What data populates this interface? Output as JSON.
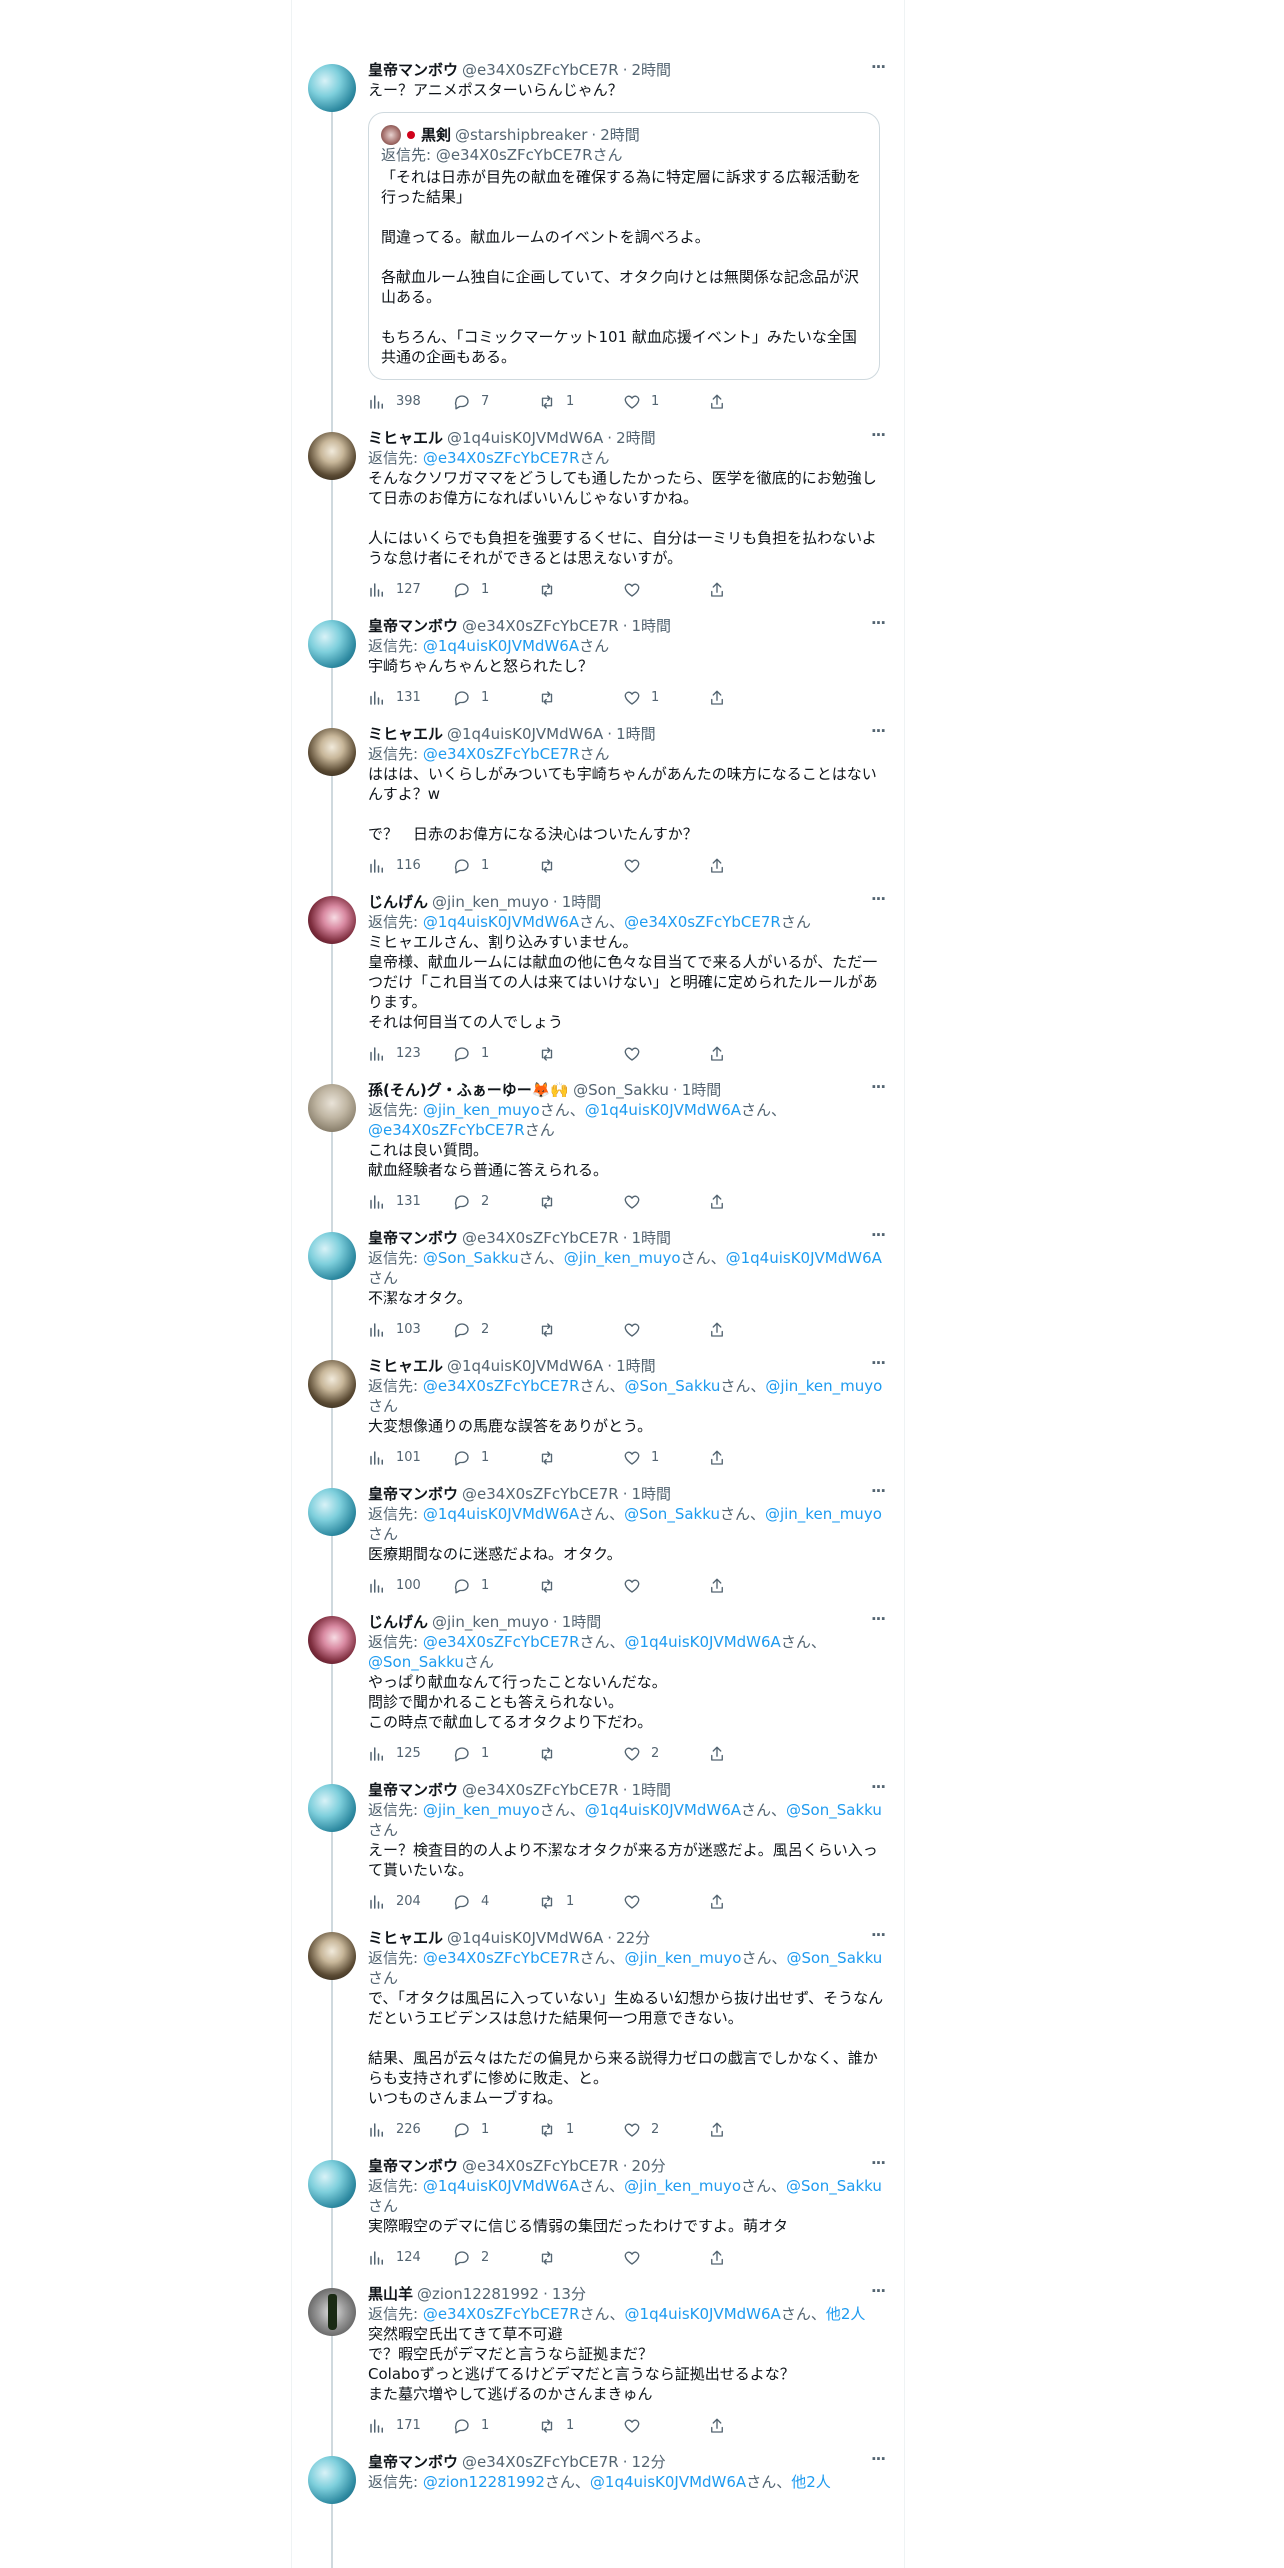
{
  "tweets": [
    {
      "avatar": "blue-whale-avatar",
      "name": "皇帝マンボウ",
      "handle": "@e34X0sZFcYbCE7R",
      "time": "2時間",
      "reply_prefix": "",
      "reply_to": [],
      "reply_suffix": "",
      "text": "えー？アニメポスターいらんじゃん？",
      "quote": {
        "name": "黒剣",
        "handle": "@starshipbreaker",
        "time": "2時間",
        "reply_label": "返信先: @e34X0sZFcYbCE7Rさん",
        "text": "「それは日赤が目先の献血を確保する為に特定層に訴求する広報活動を行った結果」\n\n間違ってる。献血ルームのイベントを調べろよ。\n\n各献血ルーム独自に企画していて、オタク向けとは無関係な記念品が沢山ある。\n\nもちろん、「コミックマーケット101 献血応援イベント」みたいな全国共通の企画もある。"
      },
      "views": "398",
      "replies": "7",
      "retweets": "1",
      "likes": "1"
    },
    {
      "avatar": "old-man-avatar",
      "name": "ミヒャエル",
      "handle": "@1q4uisK0JVMdW6A",
      "time": "2時間",
      "reply_prefix": "返信先: ",
      "reply_to": [
        "@e34X0sZFcYbCE7R"
      ],
      "reply_suffix": "さん",
      "text": "そんなクソワガママをどうしても通したかったら、医学を徹底的にお勉強して日赤のお偉方になればいいんじゃないすかね。\n\n人にはいくらでも負担を強要するくせに、自分は一ミリも負担を払わないような怠け者にそれができるとは思えないすが。",
      "views": "127",
      "replies": "1",
      "retweets": "",
      "likes": ""
    },
    {
      "avatar": "blue-whale-avatar",
      "name": "皇帝マンボウ",
      "handle": "@e34X0sZFcYbCE7R",
      "time": "1時間",
      "reply_prefix": "返信先: ",
      "reply_to": [
        "@1q4uisK0JVMdW6A"
      ],
      "reply_suffix": "さん",
      "text": "宇崎ちゃんちゃんと怒られたし？",
      "views": "131",
      "replies": "1",
      "retweets": "",
      "likes": "1"
    },
    {
      "avatar": "old-man-avatar",
      "name": "ミヒャエル",
      "handle": "@1q4uisK0JVMdW6A",
      "time": "1時間",
      "reply_prefix": "返信先: ",
      "reply_to": [
        "@e34X0sZFcYbCE7R"
      ],
      "reply_suffix": "さん",
      "text": "ははは、いくらしがみついても宇崎ちゃんがあんたの味方になることはないんすよ？w\n\nで？　日赤のお偉方になる決心はついたんすか？",
      "views": "116",
      "replies": "1",
      "retweets": "",
      "likes": ""
    },
    {
      "avatar": "anime-avatar",
      "name": "じんげん",
      "handle": "@jin_ken_muyo",
      "time": "1時間",
      "reply_prefix": "返信先: ",
      "reply_to": [
        "@1q4uisK0JVMdW6A",
        "@e34X0sZFcYbCE7R"
      ],
      "reply_suffix": "さん",
      "text": "ミヒャエルさん、割り込みすいません。\n皇帝様、献血ルームには献血の他に色々な目当てで来る人がいるが、ただ一つだけ「これ目当ての人は来てはいけない」と明確に定められたルールがあります。\nそれは何目当ての人でしょう",
      "views": "123",
      "replies": "1",
      "retweets": "",
      "likes": ""
    },
    {
      "avatar": "girl-avatar",
      "name": "孫(そん)グ・ふぁーゆー🦊🙌",
      "handle": "@Son_Sakku",
      "time": "1時間",
      "reply_prefix": "返信先: ",
      "reply_to": [
        "@jin_ken_muyo",
        "@1q4uisK0JVMdW6A",
        "@e34X0sZFcYbCE7R"
      ],
      "reply_suffix": "さん",
      "text": "これは良い質問。\n献血経験者なら普通に答えられる。",
      "views": "131",
      "replies": "2",
      "retweets": "",
      "likes": ""
    },
    {
      "avatar": "blue-whale-avatar",
      "name": "皇帝マンボウ",
      "handle": "@e34X0sZFcYbCE7R",
      "time": "1時間",
      "reply_prefix": "返信先: ",
      "reply_to": [
        "@Son_Sakku",
        "@jin_ken_muyo",
        "@1q4uisK0JVMdW6A"
      ],
      "reply_suffix": "さん",
      "text": "不潔なオタク。",
      "views": "103",
      "replies": "2",
      "retweets": "",
      "likes": ""
    },
    {
      "avatar": "old-man-avatar",
      "name": "ミヒャエル",
      "handle": "@1q4uisK0JVMdW6A",
      "time": "1時間",
      "reply_prefix": "返信先: ",
      "reply_to": [
        "@e34X0sZFcYbCE7R",
        "@Son_Sakku",
        "@jin_ken_muyo"
      ],
      "reply_suffix": "さん",
      "text": "大変想像通りの馬鹿な誤答をありがとう。",
      "views": "101",
      "replies": "1",
      "retweets": "",
      "likes": "1"
    },
    {
      "avatar": "blue-whale-avatar",
      "name": "皇帝マンボウ",
      "handle": "@e34X0sZFcYbCE7R",
      "time": "1時間",
      "reply_prefix": "返信先: ",
      "reply_to": [
        "@1q4uisK0JVMdW6A",
        "@Son_Sakku",
        "@jin_ken_muyo"
      ],
      "reply_suffix": "さん",
      "text": "医療期間なのに迷惑だよね。オタク。",
      "views": "100",
      "replies": "1",
      "retweets": "",
      "likes": ""
    },
    {
      "avatar": "anime-avatar",
      "name": "じんげん",
      "handle": "@jin_ken_muyo",
      "time": "1時間",
      "reply_prefix": "返信先: ",
      "reply_to": [
        "@e34X0sZFcYbCE7R",
        "@1q4uisK0JVMdW6A",
        "@Son_Sakku"
      ],
      "reply_suffix": "さん",
      "text": "やっぱり献血なんて行ったことないんだな。\n問診で聞かれることも答えられない。\nこの時点で献血してるオタクより下だわ。",
      "views": "125",
      "replies": "1",
      "retweets": "",
      "likes": "2"
    },
    {
      "avatar": "blue-whale-avatar",
      "name": "皇帝マンボウ",
      "handle": "@e34X0sZFcYbCE7R",
      "time": "1時間",
      "reply_prefix": "返信先: ",
      "reply_to": [
        "@jin_ken_muyo",
        "@1q4uisK0JVMdW6A",
        "@Son_Sakku"
      ],
      "reply_suffix": "さん",
      "text": "えー？検査目的の人より不潔なオタクが来る方が迷惑だよ。風呂くらい入って貰いたいな。",
      "views": "204",
      "replies": "4",
      "retweets": "1",
      "likes": ""
    },
    {
      "avatar": "old-man-avatar",
      "name": "ミヒャエル",
      "handle": "@1q4uisK0JVMdW6A",
      "time": "22分",
      "reply_prefix": "返信先: ",
      "reply_to": [
        "@e34X0sZFcYbCE7R",
        "@jin_ken_muyo",
        "@Son_Sakku"
      ],
      "reply_suffix": "さん",
      "text": "で、「オタクは風呂に入っていない」生ぬるい幻想から抜け出せず、そうなんだというエビデンスは怠けた結果何一つ用意できない。\n\n結果、風呂が云々はただの偏見から来る説得力ゼロの戯言でしかなく、誰からも支持されずに惨めに敗走、と。\nいつものさんまムーブすね。",
      "views": "226",
      "replies": "1",
      "retweets": "1",
      "likes": "2"
    },
    {
      "avatar": "blue-whale-avatar",
      "name": "皇帝マンボウ",
      "handle": "@e34X0sZFcYbCE7R",
      "time": "20分",
      "reply_prefix": "返信先: ",
      "reply_to": [
        "@1q4uisK0JVMdW6A",
        "@jin_ken_muyo",
        "@Son_Sakku"
      ],
      "reply_suffix": "さん",
      "text": "実際暇空のデマに信じる情弱の集団だったわけですよ。萌オタ",
      "views": "124",
      "replies": "2",
      "retweets": "",
      "likes": ""
    },
    {
      "avatar": "bottle-avatar",
      "name": "黒山羊",
      "handle": "@zion12281992",
      "time": "13分",
      "reply_prefix": "返信先: ",
      "reply_to": [
        "@e34X0sZFcYbCE7R",
        "@1q4uisK0JVMdW6A",
        "他2人"
      ],
      "reply_suffix": "",
      "text": "突然暇空氏出てきて草不可避\nで？暇空氏がデマだと言うなら証拠まだ？\nColaboずっと逃げてるけどデマだと言うなら証拠出せるよな？\nまた墓穴増やして逃げるのかさんまきゅん",
      "views": "171",
      "replies": "1",
      "retweets": "1",
      "likes": ""
    },
    {
      "avatar": "blue-whale-avatar",
      "name": "皇帝マンボウ",
      "handle": "@e34X0sZFcYbCE7R",
      "time": "12分",
      "reply_prefix": "返信先: ",
      "reply_to": [
        "@zion12281992",
        "@1q4uisK0JVMdW6A",
        "他2人"
      ],
      "reply_suffix": "",
      "text": "",
      "views": "",
      "replies": "",
      "retweets": "",
      "likes": ""
    }
  ]
}
